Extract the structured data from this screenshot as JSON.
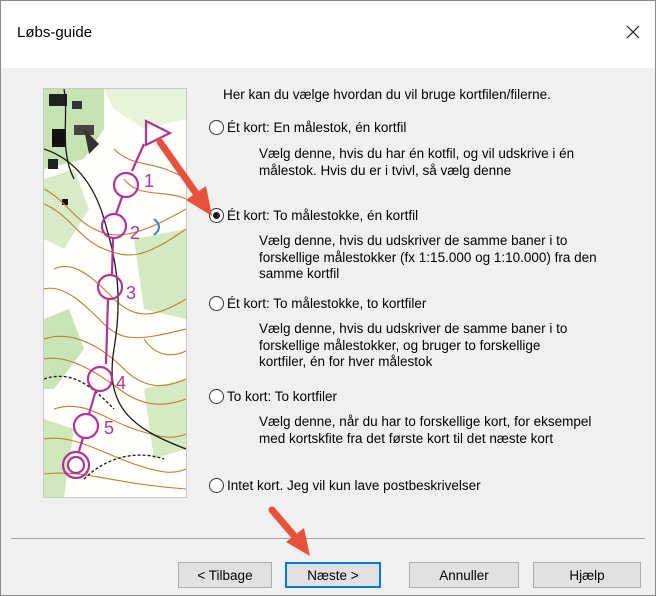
{
  "window": {
    "title": "Løbs-guide",
    "close_glyph": "✕"
  },
  "intro": "Her kan du vælge hvordan du vil bruge kortfilen/filerne.",
  "options": [
    {
      "label": "Ét kort: En målestok, én kortfil",
      "desc": [
        "Vælg denne, hvis du har én kotfil, og vil udskrive i én",
        "målestok.  Hvis du er i tvivl, så vælg denne"
      ],
      "checked": false
    },
    {
      "label": "Ét kort: To målestokke, én kortfil",
      "desc": [
        "Vælg denne, hvis du udskriver de samme baner i to",
        "forskellige målestokker (fx 1:15.000 og 1:10.000) fra den",
        "samme kortfil"
      ],
      "checked": true
    },
    {
      "label": "Ét kort: To målestokke, to kortfiler",
      "desc": [
        "Vælg denne, hvis du udskriver de samme baner i to",
        "forskellige målestokker, og bruger to forskellige",
        "kortfiler, én for hver målestok"
      ],
      "checked": false
    },
    {
      "label": "To kort: To kortfiler",
      "desc": [
        "Vælg denne, når du har to forskellige kort, for eksempel",
        "med kortskfite fra det første kort til det næste kort"
      ],
      "checked": false
    },
    {
      "label": "Intet kort.  Jeg vil kun lave postbeskrivelser",
      "desc": [],
      "checked": false
    }
  ],
  "buttons": {
    "back": "< Tilbage",
    "next": "Næste >",
    "cancel": "Annuller",
    "help": "Hjælp"
  },
  "colors": {
    "accent": "#0078d7",
    "annotation_arrow": "#e8523a",
    "course_purple": "#b0339a"
  },
  "icons": {
    "close": "close-icon",
    "map": "orienteering-map-image",
    "arrow": "annotation-arrow"
  }
}
